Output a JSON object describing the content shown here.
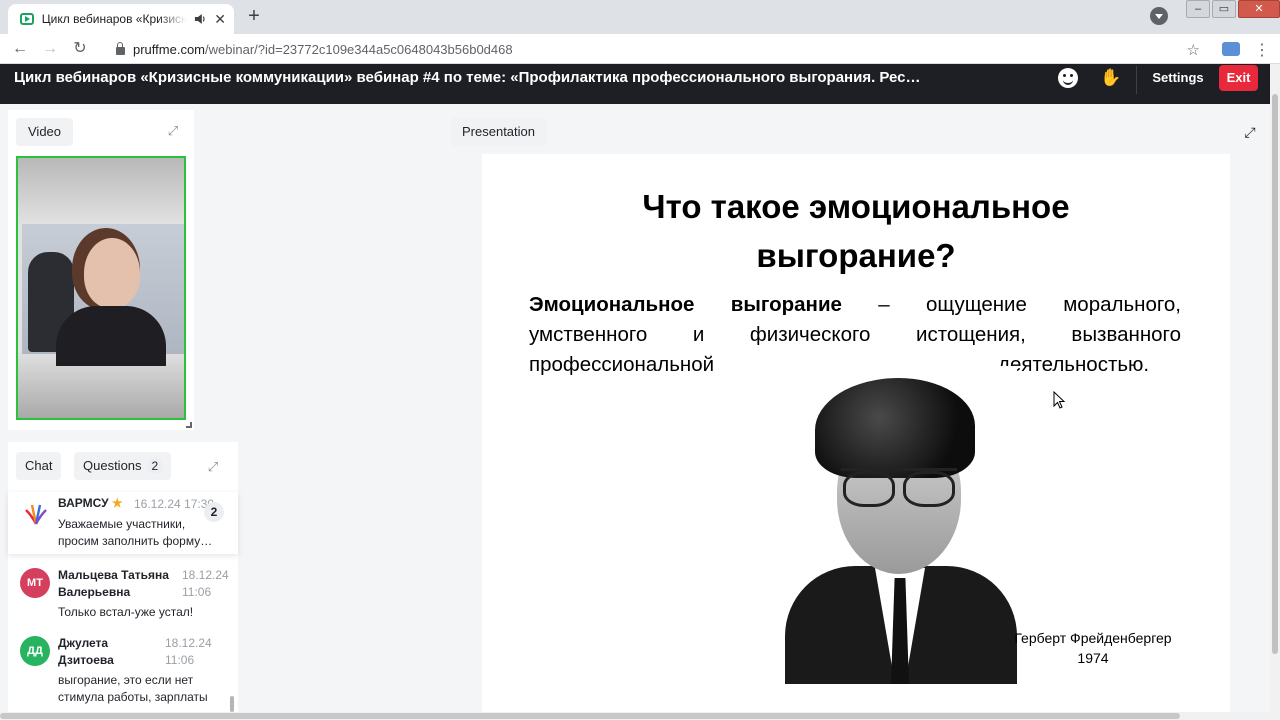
{
  "browser": {
    "tab_title": "Цикл вебинаров «Кризисные коммуникации»",
    "url_host": "pruffme.com",
    "url_path": "/webinar/?id=23772c109e344a5c0648043b56b0d468"
  },
  "header": {
    "title": "Цикл вебинаров «Кризисные коммуникации» вебинар #4 по теме: «Профилактика профессионального выгорания. Рес…",
    "settings_label": "Settings",
    "exit_label": "Exit"
  },
  "video": {
    "label": "Video"
  },
  "chat": {
    "tab_chat": "Chat",
    "tab_questions": "Questions",
    "questions_count": "2",
    "pinned": {
      "author": "ВАРМСУ",
      "time": "16.12.24 17:30",
      "text_line1": "Уважаемые участники,",
      "text_line2": "просим заполнить форму…",
      "count": "2"
    },
    "messages": [
      {
        "initials": "МТ",
        "author_line1": "Мальцева Татьяна",
        "author_line2": "Валерьевна",
        "date": "18.12.24",
        "time": "11:06",
        "text_line1": "Только встал-уже устал!",
        "text_line2": ""
      },
      {
        "initials": "ДД",
        "author_line1": "Джулета",
        "author_line2": "Дзитоева",
        "date": "18.12.24",
        "time": "11:06",
        "text_line1": "выгорание, это если нет",
        "text_line2": "стимула работы, зарплаты"
      }
    ]
  },
  "presentation": {
    "label": "Presentation",
    "slide": {
      "title_line1": "Что такое эмоциональное",
      "title_line2": "выгорание?",
      "term": "Эмоциональное выгорание",
      "def_rest": "– ощущение морального, умственного и физического истощения, вызванного",
      "def_last_start": "профессиональной",
      "def_last_end": "деятельностью.",
      "caption_name": "Герберт Фрейденбергер",
      "caption_year": "1974"
    }
  },
  "colors": {
    "header_bg": "#1d1f24",
    "exit_red": "#e8283b",
    "video_border": "#29c23a",
    "avatar_mt": "#d43f5e",
    "avatar_dd": "#27b35f"
  }
}
